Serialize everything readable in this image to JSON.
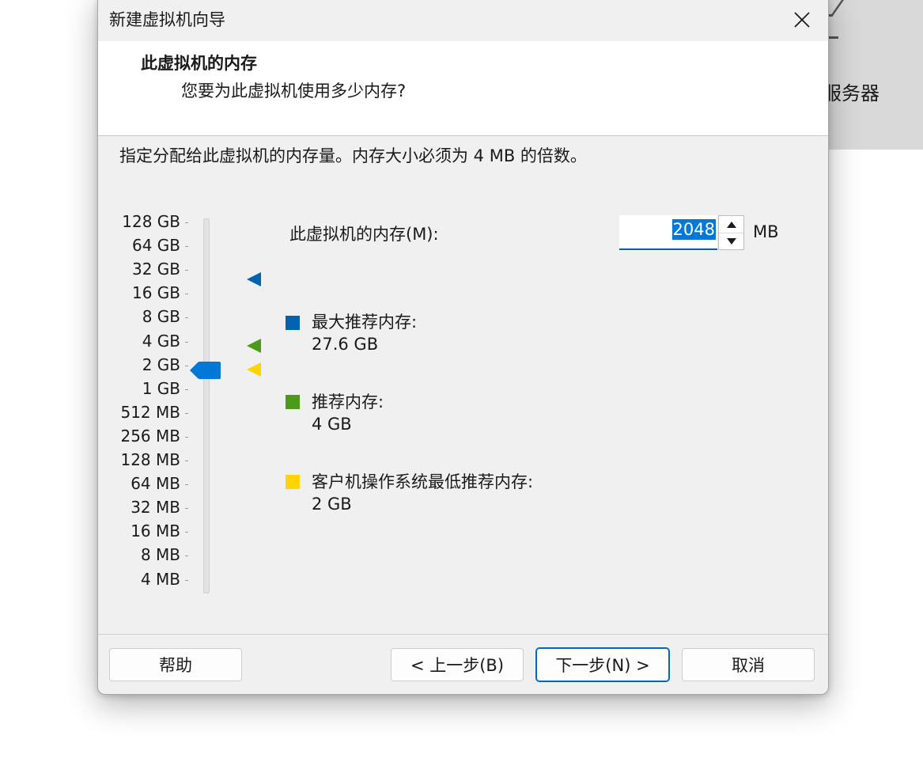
{
  "background": {
    "partial_text": "服务器"
  },
  "dialog": {
    "title": "新建虚拟机向导",
    "header": {
      "title": "此虚拟机的内存",
      "subtitle": "您要为此虚拟机使用多少内存?"
    },
    "instructions": "指定分配给此虚拟机的内存量。内存大小必须为 4 MB 的倍数。",
    "scale_labels": [
      "128 GB",
      "64 GB",
      "32 GB",
      "16 GB",
      "8 GB",
      "4 GB",
      "2 GB",
      "1 GB",
      "512 MB",
      "256 MB",
      "128 MB",
      "64 MB",
      "32 MB",
      "16 MB",
      "8 MB",
      "4 MB"
    ],
    "memory_field": {
      "label": "此虚拟机的内存(M):",
      "value": "2048",
      "unit": "MB"
    },
    "legend": [
      {
        "label": "最大推荐内存:",
        "value": "27.6 GB",
        "color": "#0063b1"
      },
      {
        "label": "推荐内存:",
        "value": "4 GB",
        "color": "#4b9a1a"
      },
      {
        "label": "客户机操作系统最低推荐内存:",
        "value": "2 GB",
        "color": "#ffd400"
      }
    ],
    "buttons": {
      "help": "帮助",
      "back": "< 上一步(B)",
      "next": "下一步(N) >",
      "cancel": "取消"
    }
  }
}
